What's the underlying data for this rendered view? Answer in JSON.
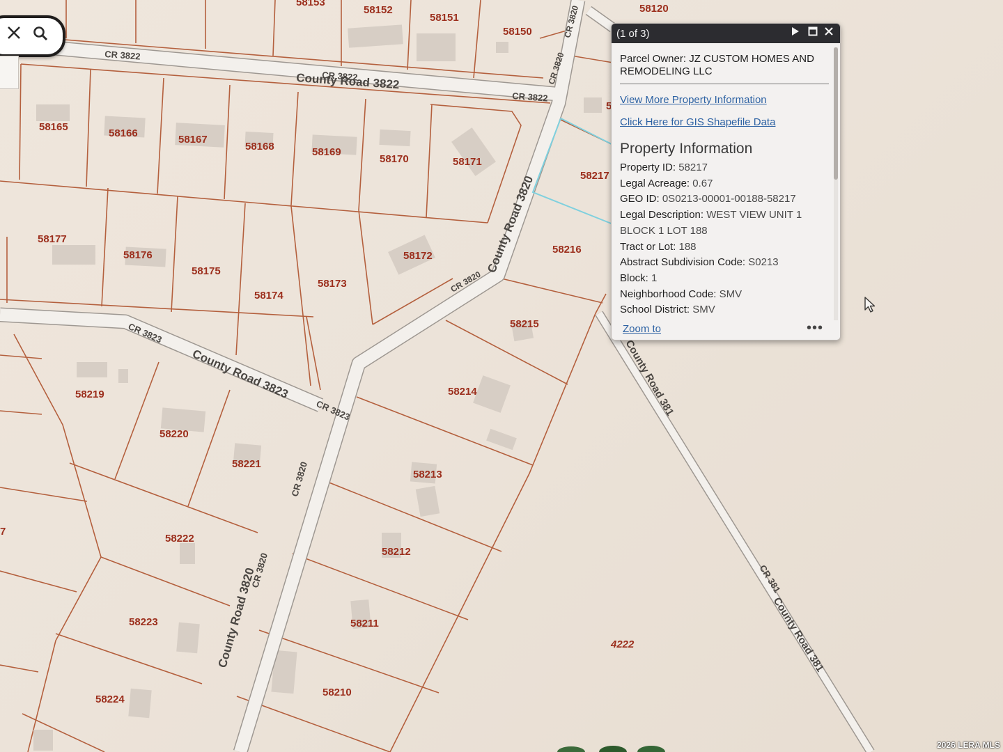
{
  "map": {
    "parcels": [
      {
        "id": "58153",
        "label": "58153"
      },
      {
        "id": "58152",
        "label": "58152"
      },
      {
        "id": "58151",
        "label": "58151"
      },
      {
        "id": "58150",
        "label": "58150"
      },
      {
        "id": "58120",
        "label": "58120"
      },
      {
        "id": "58165",
        "label": "58165"
      },
      {
        "id": "58166",
        "label": "58166"
      },
      {
        "id": "58167",
        "label": "58167"
      },
      {
        "id": "58168",
        "label": "58168"
      },
      {
        "id": "58169",
        "label": "58169"
      },
      {
        "id": "58170",
        "label": "58170"
      },
      {
        "id": "58171",
        "label": "58171"
      },
      {
        "id": "58177",
        "label": "58177"
      },
      {
        "id": "58176",
        "label": "58176"
      },
      {
        "id": "58175",
        "label": "58175"
      },
      {
        "id": "58174",
        "label": "58174"
      },
      {
        "id": "58173",
        "label": "58173"
      },
      {
        "id": "58172",
        "label": "58172"
      },
      {
        "id": "58217",
        "label": "58217"
      },
      {
        "id": "58216",
        "label": "58216"
      },
      {
        "id": "58215",
        "label": "58215"
      },
      {
        "id": "58214",
        "label": "58214"
      },
      {
        "id": "58213",
        "label": "58213"
      },
      {
        "id": "58212",
        "label": "58212"
      },
      {
        "id": "58211",
        "label": "58211"
      },
      {
        "id": "58210",
        "label": "58210"
      },
      {
        "id": "58219",
        "label": "58219"
      },
      {
        "id": "58220",
        "label": "58220"
      },
      {
        "id": "58221",
        "label": "58221"
      },
      {
        "id": "58222",
        "label": "58222"
      },
      {
        "id": "58223",
        "label": "58223"
      },
      {
        "id": "58224",
        "label": "58224"
      },
      {
        "id": "4222",
        "label": "4222"
      },
      {
        "id": "5",
        "label": "5"
      },
      {
        "id": "7",
        "label": "7"
      }
    ],
    "roads": [
      {
        "id": "cr3822-a",
        "label": "CR 3822"
      },
      {
        "id": "cr3822-b",
        "label": "CR 3822"
      },
      {
        "id": "county-road-3822",
        "label": "County Road 3822"
      },
      {
        "id": "cr3822-c",
        "label": "CR 3822"
      },
      {
        "id": "cr3823-a",
        "label": "CR 3823"
      },
      {
        "id": "county-road-3823",
        "label": "County Road 3823"
      },
      {
        "id": "cr3823-b",
        "label": "CR 3823"
      },
      {
        "id": "cr3820-a",
        "label": "CR 3820"
      },
      {
        "id": "cr3820-b",
        "label": "CR 3820"
      },
      {
        "id": "county-road-3820-a",
        "label": "County Road 3820"
      },
      {
        "id": "cr3820-c",
        "label": "CR 3820"
      },
      {
        "id": "cr3820-d",
        "label": "CR 3820"
      },
      {
        "id": "county-road-3820-b",
        "label": "County Road 3820"
      },
      {
        "id": "cr3820-e",
        "label": "CR 3820"
      },
      {
        "id": "county-road-381-a",
        "label": "County Road 381"
      },
      {
        "id": "cr381",
        "label": "CR 381"
      },
      {
        "id": "county-road-381-b",
        "label": "County Road 381"
      }
    ]
  },
  "search": {
    "clear_icon": "close-icon",
    "search_icon": "search-icon"
  },
  "popup": {
    "count": "(1 of 3)",
    "owner_label": "Parcel Owner: JZ CUSTOM HOMES AND REMODELING LLC",
    "link_more": "View More Property Information",
    "link_gis": "Click Here for GIS Shapefile Data",
    "section_title": "Property Information",
    "fields": [
      {
        "key": "Property ID:",
        "value": "58217"
      },
      {
        "key": "Legal Acreage:",
        "value": "0.67"
      },
      {
        "key": "GEO ID:",
        "value": "0S0213-00001-00188-58217"
      },
      {
        "key": "Legal Description:",
        "value": "WEST VIEW UNIT 1"
      },
      {
        "key": "",
        "value": "BLOCK 1 LOT 188"
      },
      {
        "key": "Tract or Lot:",
        "value": "188"
      },
      {
        "key": "Abstract Subdivision Code:",
        "value": "S0213"
      },
      {
        "key": "Block:",
        "value": "1"
      },
      {
        "key": "Neighborhood Code:",
        "value": "SMV"
      },
      {
        "key": "School District:",
        "value": "SMV"
      }
    ],
    "zoom_label": "Zoom to",
    "more_label": "•••",
    "icons": {
      "next": "play-next-icon",
      "maximize": "maximize-icon",
      "close": "close-icon"
    }
  },
  "watermark": "2026 LERA MLS",
  "colors": {
    "parcel_line": "#b4603e",
    "parcel_label": "#9c2f1d",
    "road_fill": "#f3f0ec",
    "map_background": "#ece3d9",
    "popup_header": "#2c2c30",
    "popup_link": "#2d62a3",
    "selection": "#7fd0de"
  }
}
